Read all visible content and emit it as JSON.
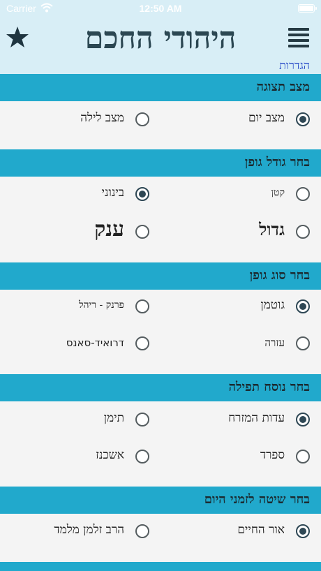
{
  "status": {
    "carrier": "Carrier",
    "time": "12:50 AM"
  },
  "header": {
    "title": "היהודי החכם",
    "nav_link": "הגדרות"
  },
  "sections": [
    {
      "title": "מצב תצוגה",
      "options": [
        {
          "label": "מצב יום",
          "selected": true
        },
        {
          "label": "מצב לילה",
          "selected": false
        }
      ]
    },
    {
      "title": "בחר גודל גופן",
      "options": [
        {
          "label": "קטן",
          "selected": false
        },
        {
          "label": "בינוני",
          "selected": true
        },
        {
          "label": "גדול",
          "selected": false
        },
        {
          "label": "ענק",
          "selected": false
        }
      ]
    },
    {
      "title": "בחר סוג גופן",
      "options": [
        {
          "label": "גוטמן",
          "selected": true
        },
        {
          "label": "פרנק - ריהל",
          "selected": false
        },
        {
          "label": "עזרה",
          "selected": false
        },
        {
          "label": "דרואיד-סאנס",
          "selected": false
        }
      ]
    },
    {
      "title": "בחר נוסח תפילה",
      "options": [
        {
          "label": "עדות המזרח",
          "selected": true
        },
        {
          "label": "תימן",
          "selected": false
        },
        {
          "label": "ספרד",
          "selected": false
        },
        {
          "label": "אשכנז",
          "selected": false
        }
      ]
    },
    {
      "title": "בחר שיטה לזמני היום",
      "options": [
        {
          "label": "אור החיים",
          "selected": true
        },
        {
          "label": "הרב זלמן מלמד",
          "selected": false
        }
      ]
    }
  ],
  "colors": {
    "header_bg": "#d8eef6",
    "section_bar": "#21a9cc",
    "title": "#2b4752",
    "link": "#2a4cc8",
    "radio_selected": "#2e4754"
  },
  "icons": [
    "star-icon",
    "menu-icon",
    "wifi-icon",
    "battery-icon"
  ]
}
